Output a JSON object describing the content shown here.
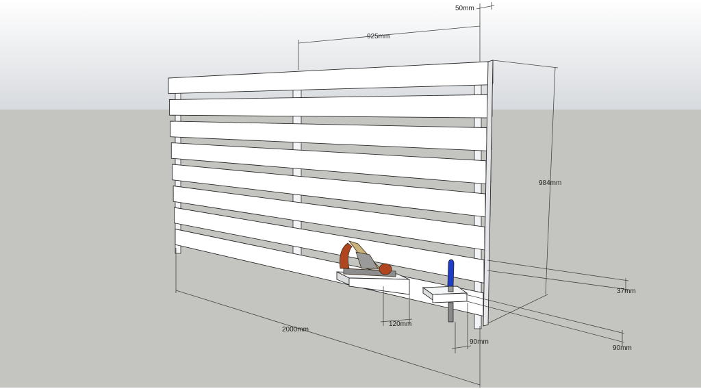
{
  "colors": {
    "sky_top": "#ffffff",
    "sky_bottom": "#d7dade",
    "ground": "#c4c5c0",
    "slat_face": "#ffffff",
    "slat_edge": "#d9dbdd",
    "line": "#2a2a2a",
    "dimension_line": "#444444",
    "plane_handle": "#b0461f",
    "plane_body": "#9a9a9a",
    "chisel_handle": "#1e3ec7"
  },
  "dimensions": {
    "top_depth": "50mm",
    "post_spacing": "925mm",
    "height": "984mm",
    "length": "2000mm",
    "slat_thickness": "37mm",
    "shelf_gap": "120mm",
    "holder_width": "90mm",
    "holder_depth": "90mm"
  },
  "objects": {
    "plane_icon": "hand-plane-icon",
    "chisel_icon": "chisel-icon"
  }
}
